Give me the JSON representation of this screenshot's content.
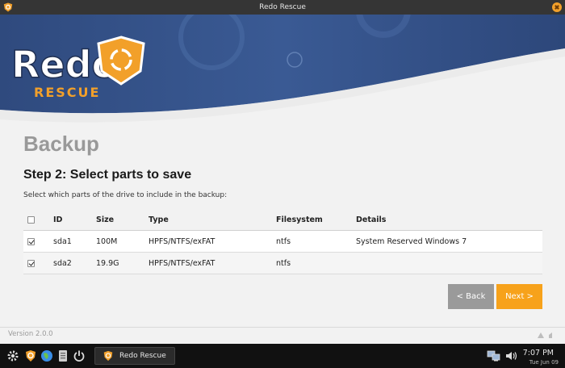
{
  "window": {
    "title": "Redo Rescue"
  },
  "logo": {
    "word1": "Redo",
    "word2": "RESCUE"
  },
  "page": {
    "title": "Backup",
    "step_title": "Step 2: Select parts to save",
    "instructions": "Select which parts of the drive to include in the backup:"
  },
  "table": {
    "headers": {
      "id": "ID",
      "size": "Size",
      "type": "Type",
      "filesystem": "Filesystem",
      "details": "Details"
    },
    "header_checkbox_checked": false,
    "rows": [
      {
        "checked": true,
        "id": "sda1",
        "size": "100M",
        "type": "HPFS/NTFS/exFAT",
        "filesystem": "ntfs",
        "details": "System Reserved Windows 7"
      },
      {
        "checked": true,
        "id": "sda2",
        "size": "19.9G",
        "type": "HPFS/NTFS/exFAT",
        "filesystem": "ntfs",
        "details": ""
      }
    ]
  },
  "buttons": {
    "back": "< Back",
    "next": "Next >"
  },
  "footer": {
    "version": "Version 2.0.0"
  },
  "taskbar": {
    "task_label": "Redo Rescue",
    "time": "7:07 PM",
    "date": "Tue Jun 09",
    "icons": [
      "gear-icon",
      "redo-rescue-icon",
      "browser-icon",
      "file-manager-icon",
      "power-icon",
      "network-icon",
      "volume-icon"
    ]
  },
  "colors": {
    "accent": "#f7a21b",
    "banner": "#34528a",
    "back_button": "#9a9a9a",
    "title_gray": "#999999"
  }
}
